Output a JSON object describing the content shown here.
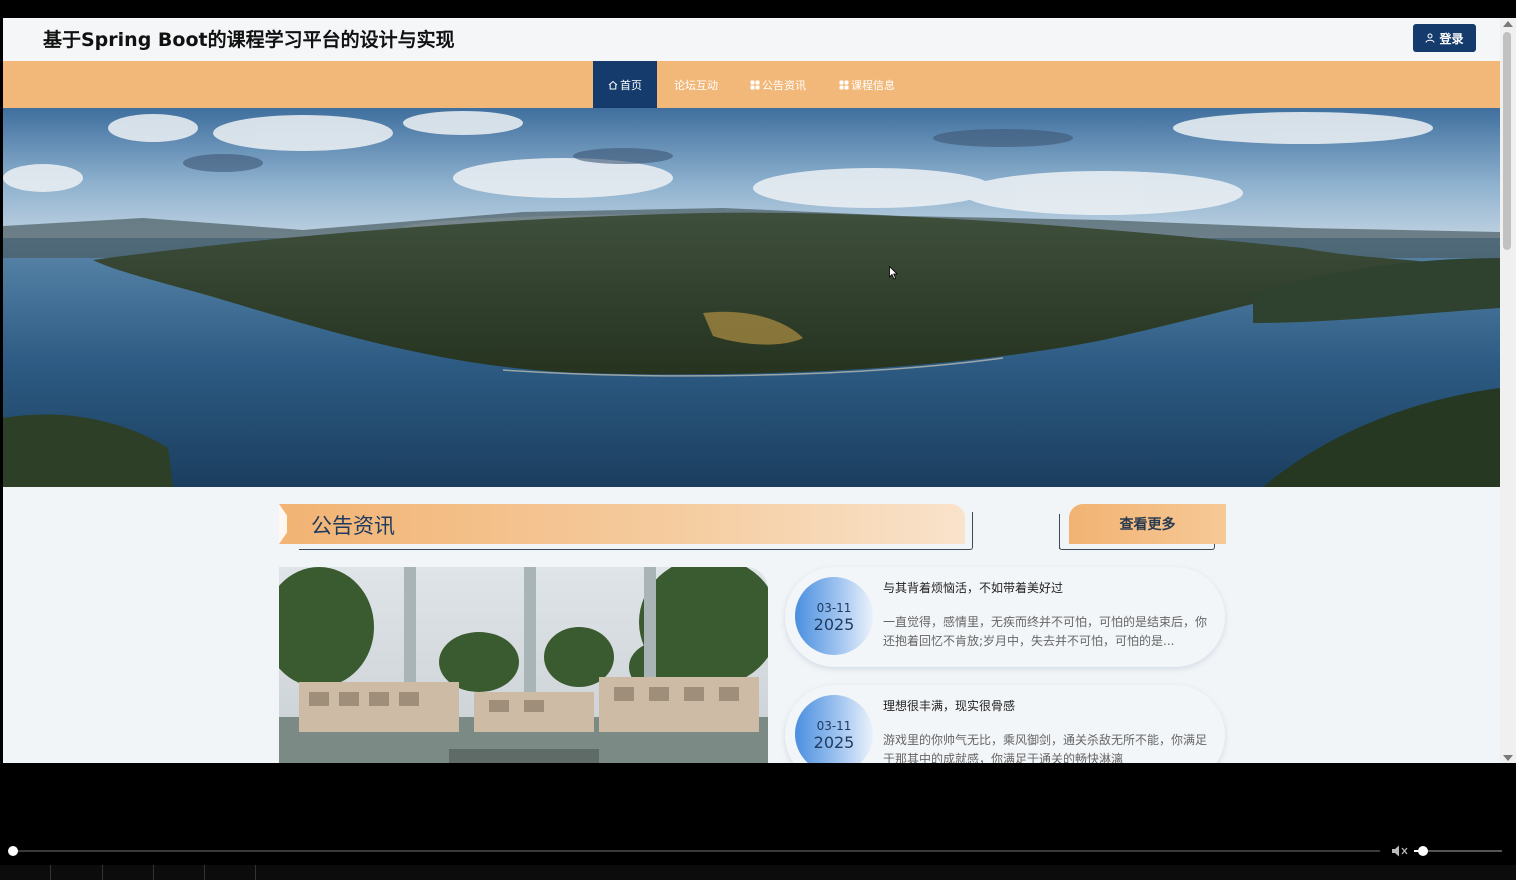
{
  "header": {
    "site_title": "基于Spring Boot的课程学习平台的设计与实现",
    "login_label": "登录"
  },
  "nav": {
    "items": [
      {
        "label": "首页",
        "icon": "home-icon",
        "active": true
      },
      {
        "label": "论坛互动",
        "icon": "",
        "active": false
      },
      {
        "label": "公告资讯",
        "icon": "grid-icon",
        "active": false
      },
      {
        "label": "课程信息",
        "icon": "grid-icon",
        "active": false
      }
    ]
  },
  "banner": {
    "image": "aerial lake and forested hills landscape"
  },
  "announcements": {
    "section_title": "公告资讯",
    "more_label": "查看更多",
    "items": [
      {
        "date_md": "03-11",
        "year": "2025",
        "title": "与其背着烦恼活，不如带着美好过",
        "body": "一直觉得，感情里，无疾而终并不可怕，可怕的是结束后，你还抱着回忆不肯放;岁月中，失去并不可怕，可怕的是..."
      },
      {
        "date_md": "03-11",
        "year": "2025",
        "title": "理想很丰满，现实很骨感",
        "body": "游戏里的你帅气无比，乘风御剑，通关杀敌无所不能，你满足于那其中的成就感，你满足于通关的畅快淋漓"
      }
    ]
  },
  "player": {
    "progress": 0.0,
    "volume": 0.1
  },
  "colors": {
    "nav_bg": "#f2b87a",
    "active_nav": "#153a6c",
    "login_btn": "#153a6c",
    "page_bg": "#f2f5f7"
  }
}
